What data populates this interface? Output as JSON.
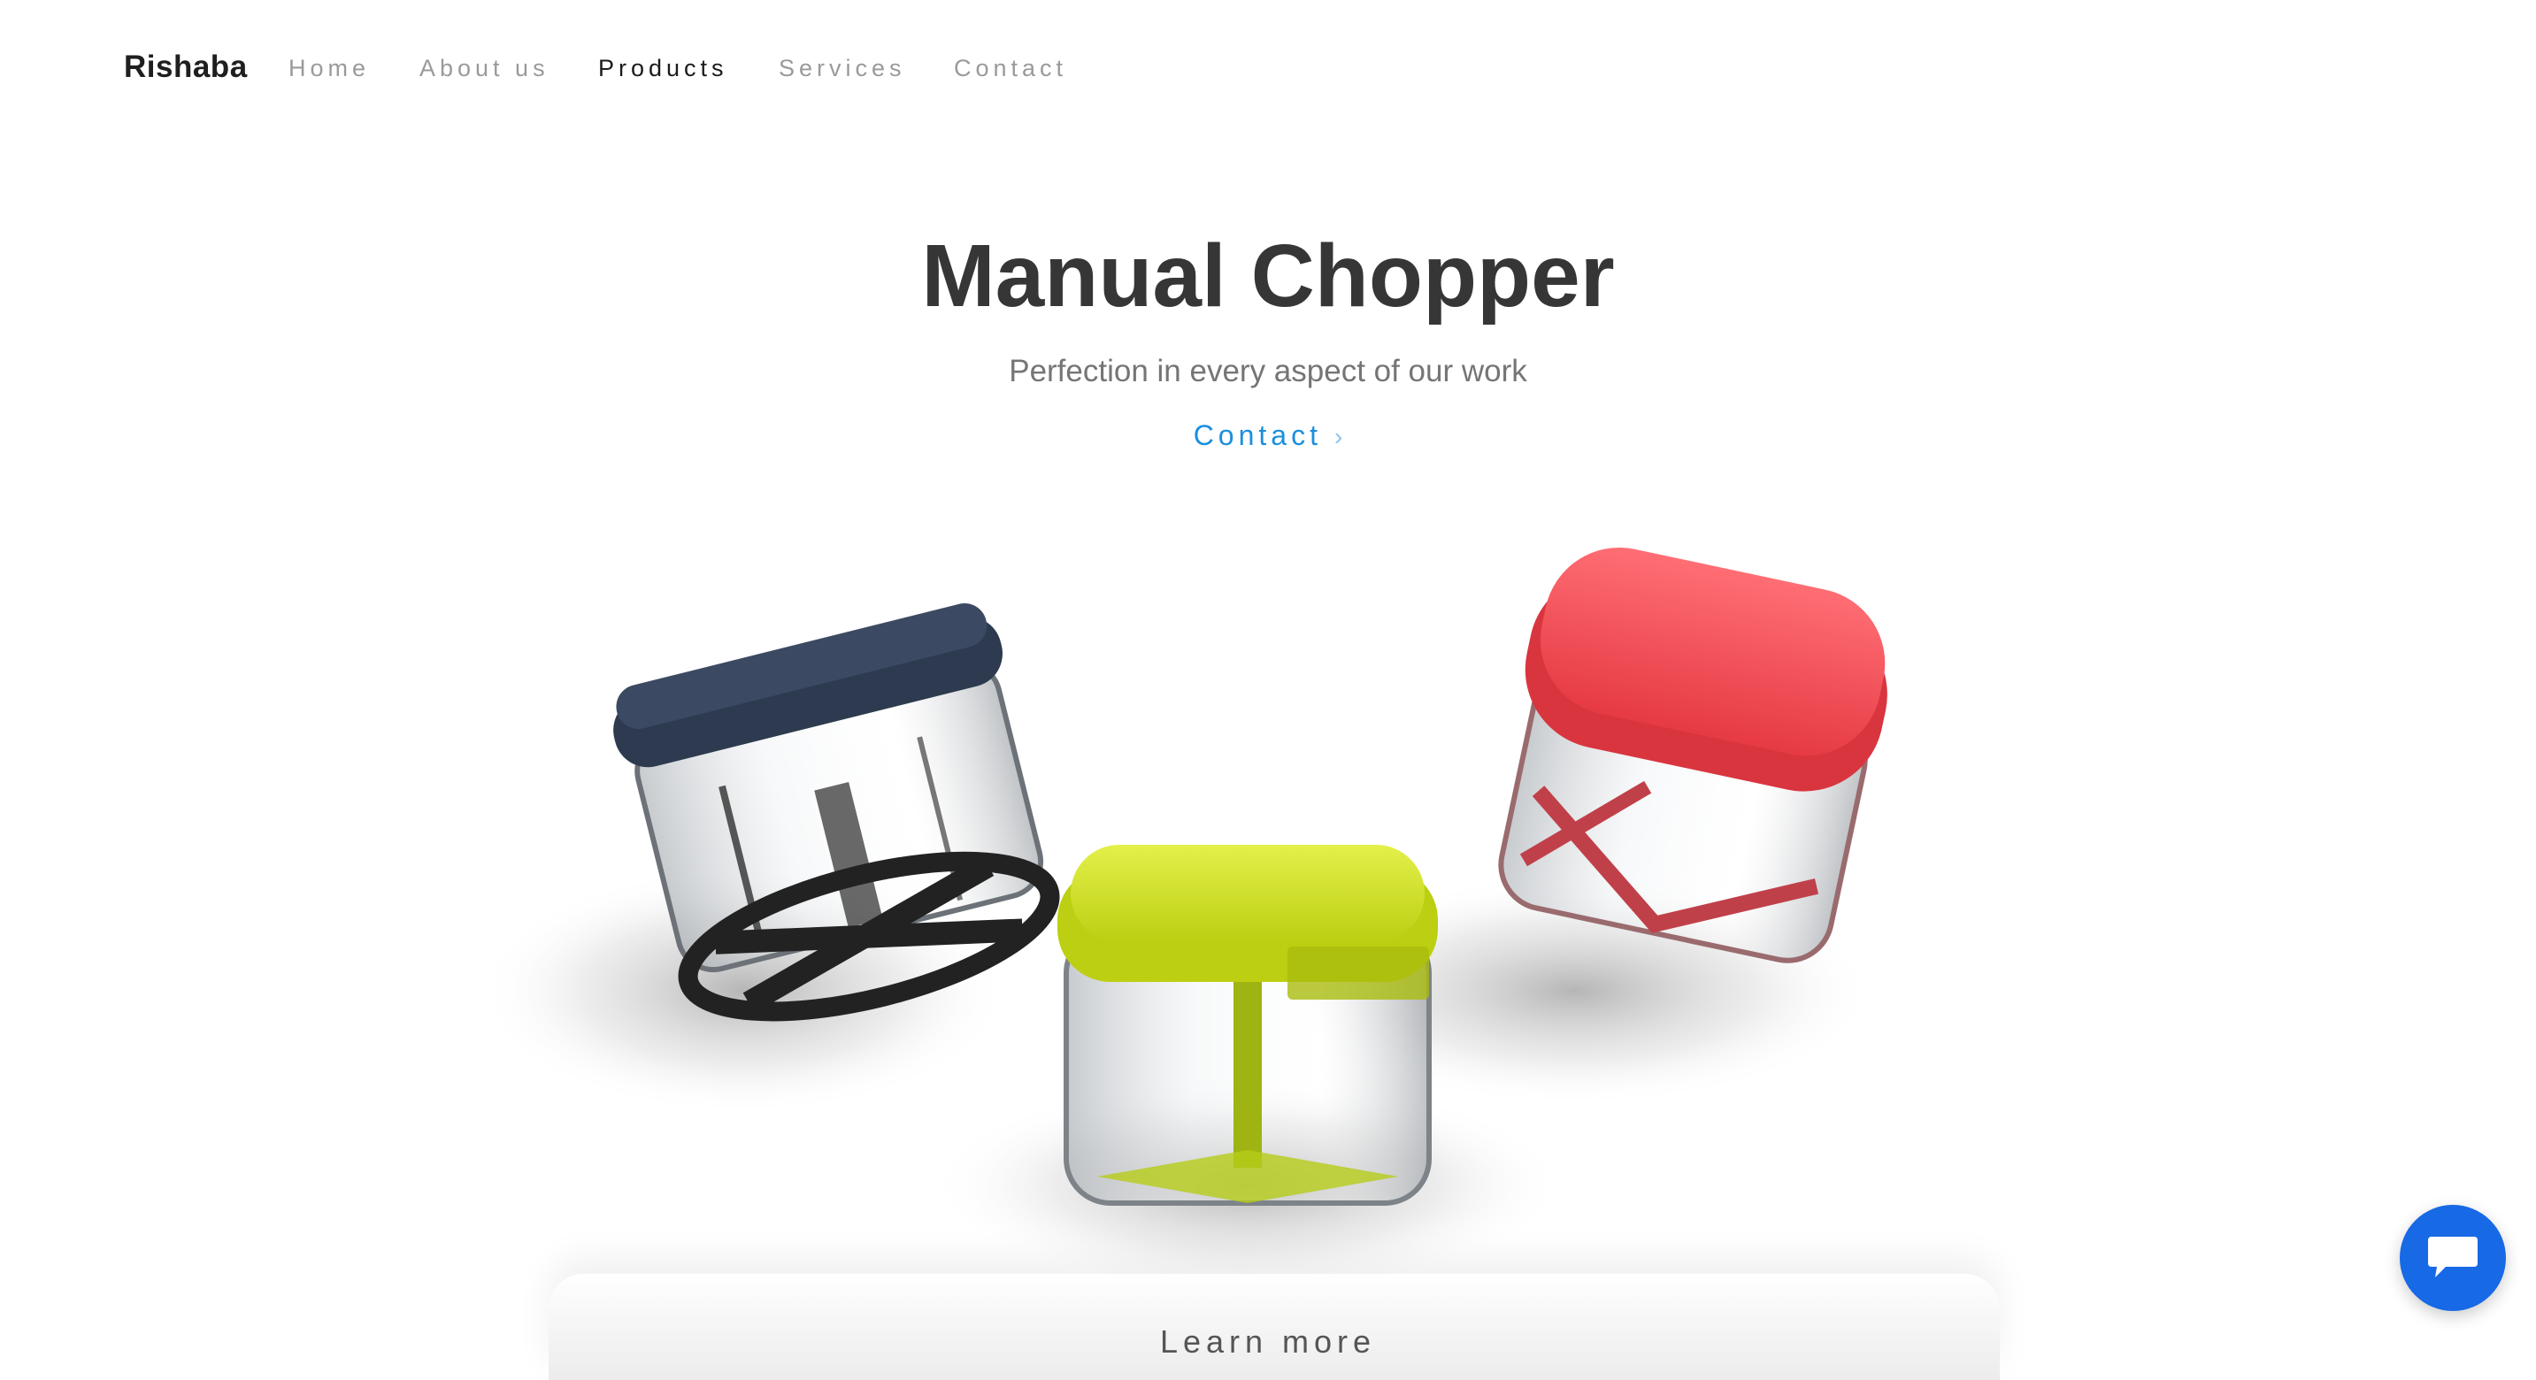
{
  "nav": {
    "brand": "Rishaba",
    "links": [
      {
        "label": "Home"
      },
      {
        "label": "About us"
      },
      {
        "label": "Products",
        "active": true
      },
      {
        "label": "Services"
      },
      {
        "label": "Contact"
      }
    ]
  },
  "hero": {
    "title": "Manual Chopper",
    "subtitle": "Perfection in every aspect of our work",
    "cta_label": "Contact",
    "cta_icon": "chevron-right-icon"
  },
  "products": [
    {
      "name": "chopper-navy",
      "lid_color": "#2d3a4f"
    },
    {
      "name": "chopper-lime",
      "lid_color": "#c9dc17"
    },
    {
      "name": "chopper-red",
      "lid_color": "#f2454f"
    }
  ],
  "footer": {
    "learn_more": "Learn more"
  },
  "chat": {
    "icon": "chat-bubble-icon",
    "color": "#1769e6"
  }
}
